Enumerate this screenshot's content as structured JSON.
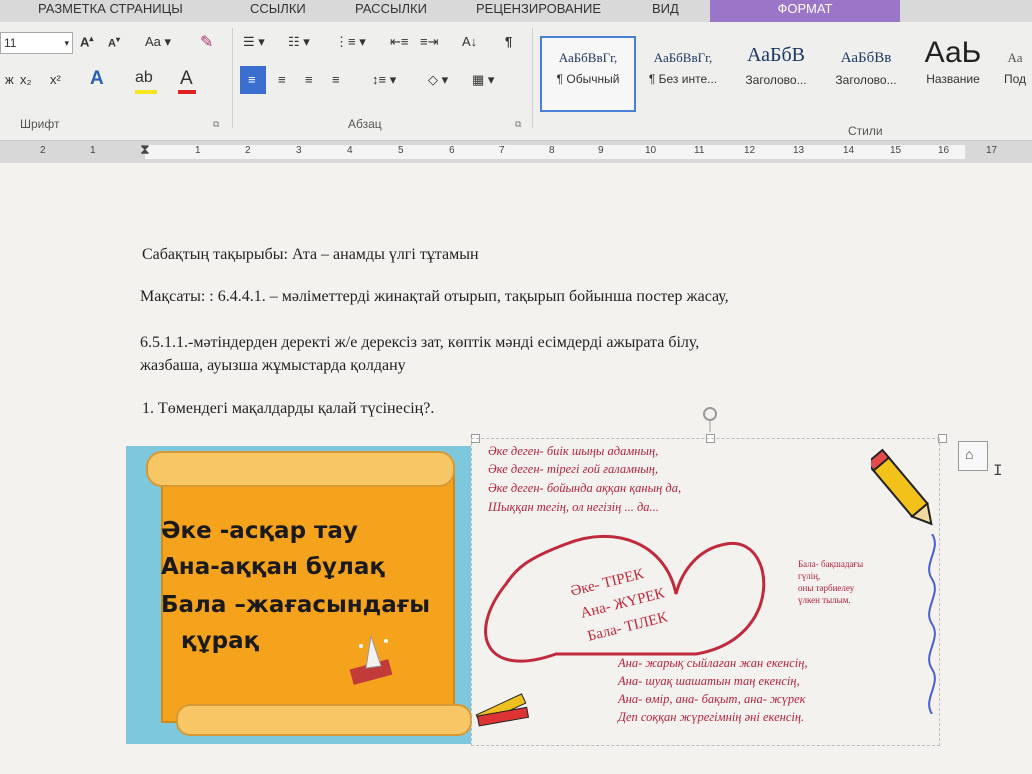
{
  "tabs": [
    {
      "label": "РАЗМЕТКА СТРАНИЦЫ"
    },
    {
      "label": "ССЫЛКИ"
    },
    {
      "label": "РАССЫЛКИ"
    },
    {
      "label": "РЕЦЕНЗИРОВАНИЕ"
    },
    {
      "label": "ВИД"
    },
    {
      "label": "ФОРМАТ"
    }
  ],
  "ribbon": {
    "font_size": "11",
    "change_case": "Aa",
    "grow_font": "A",
    "shrink_font": "A",
    "subscript": "x₂",
    "superscript": "x²",
    "font_group_label": "Шрифт",
    "paragraph_group_label": "Абзац",
    "styles_group_label": "Стили",
    "styles": [
      {
        "preview": "АаБбВвГг,",
        "name": "¶ Обычный"
      },
      {
        "preview": "АаБбВвГг,",
        "name": "¶ Без инте..."
      },
      {
        "preview": "АаБбВ",
        "name": "Заголово..."
      },
      {
        "preview": "АаБбВв",
        "name": "Заголово..."
      },
      {
        "preview": "АаЬ",
        "name": "Название"
      },
      {
        "preview": "Аа",
        "name": "Под"
      }
    ]
  },
  "ruler": {
    "numbers": [
      "2",
      "1",
      "1",
      "2",
      "3",
      "4",
      "5",
      "6",
      "7",
      "8",
      "9",
      "10",
      "11",
      "12",
      "13",
      "14",
      "15",
      "16",
      "17"
    ]
  },
  "document": {
    "line1": "Сабақтың тақырыбы: Ата – анамды үлгі тұтамын",
    "line2": "Мақсаты:  :  6.4.4.1. – мәліметтерді жинақтай отырып, тақырып бойынша постер жасау,",
    "line3": "6.5.1.1.-мәтіндерден  деректі ж/е дерексіз зат, көптік мәнді есімдерді  ажырата білу,",
    "line4": "жазбаша, ауызша жұмыстарда қолдану",
    "line5": "1.   Төмендегі мақалдарды қалай түсінесің?."
  },
  "poster": {
    "proverbs": [
      "Әке -асқар тау",
      "Ана-аққан бұлақ",
      "Бала –жағасындағы",
      "құрақ"
    ],
    "poem_top": [
      "Әке деген- биік шыңы адамның,",
      "Әке деген- тірегі ғой ғаламның,",
      "Әке деген- бойында аққан қаның да,",
      "Шыққан тегің, ол негізің ... да..."
    ],
    "heart_lines": [
      "Әке- ТІРЕК",
      "Ана- ЖҮРЕК",
      "Бала- ТІЛЕК"
    ],
    "side_note": [
      "Бала- бақшадағы",
      "гүлің,",
      "оны тәрбиелеу",
      "үлкен тылым."
    ],
    "poem_bottom": [
      "Ана- жарық сыйлаған жан екенсің,",
      "Ана- шуақ шашатын таң екенсің,",
      "Ана- өмір, ана- бақыт, ана- жүрек",
      "Деп соққан жүрегімнің әні екенсің."
    ]
  },
  "colors": {
    "format_tab": "#9b76c8",
    "poster_orange": "#f5a31c",
    "poster_blue": "#7ec8de",
    "poem_red": "#b5223d"
  }
}
